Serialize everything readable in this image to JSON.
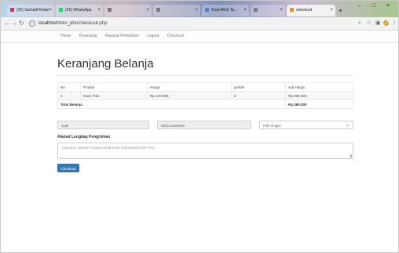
{
  "browser": {
    "tabs": [
      {
        "label": "(25) Sumatif Kelas",
        "fav_color": "#e0245e"
      },
      {
        "label": "(25) WhatsApp",
        "fav_color": "#25d366"
      },
      {
        "label": "",
        "fav_color": "#7a7a7a"
      },
      {
        "label": "",
        "fav_color": "#7a7a7a"
      },
      {
        "label": "Soal Akhir Ta...",
        "fav_color": "#4a7bd0"
      },
      {
        "label": "",
        "fav_color": "#7a7a7a"
      },
      {
        "label": "checkout",
        "fav_color": "#f08a24"
      }
    ],
    "window_controls": "– □ ×",
    "address": {
      "host": "localhost",
      "path": "/toko_pbo/checkout.php"
    },
    "toolbar_icons": [
      "search-icon",
      "star-icon",
      "extensions-icon",
      "menu-icon"
    ]
  },
  "nav": {
    "items": [
      "Home",
      "Keranjang",
      "Riwayat Pembelian",
      "Logout",
      "Checkout"
    ]
  },
  "page": {
    "title": "Keranjang Belanja"
  },
  "table": {
    "headers": [
      "No",
      "Produk",
      "Harga",
      "jumlah",
      "sub Harga"
    ],
    "rows": [
      [
        "1",
        "Kaos Polo",
        "Rp.120,000,-",
        "3",
        "Rp.360,000,-"
      ]
    ],
    "total_label": "Total Belanja",
    "total_value": "Rp.360,000"
  },
  "form": {
    "name_value": "syafi",
    "phone_value": "082154025646",
    "select_value": "Pilih Ongkir",
    "address_label": "Alamat Lengkap Pengiriman",
    "address_placeholder": "masukan alamat lengkap pengiriman (Termasuk Kode Pos)",
    "submit_label": "Checkout"
  }
}
